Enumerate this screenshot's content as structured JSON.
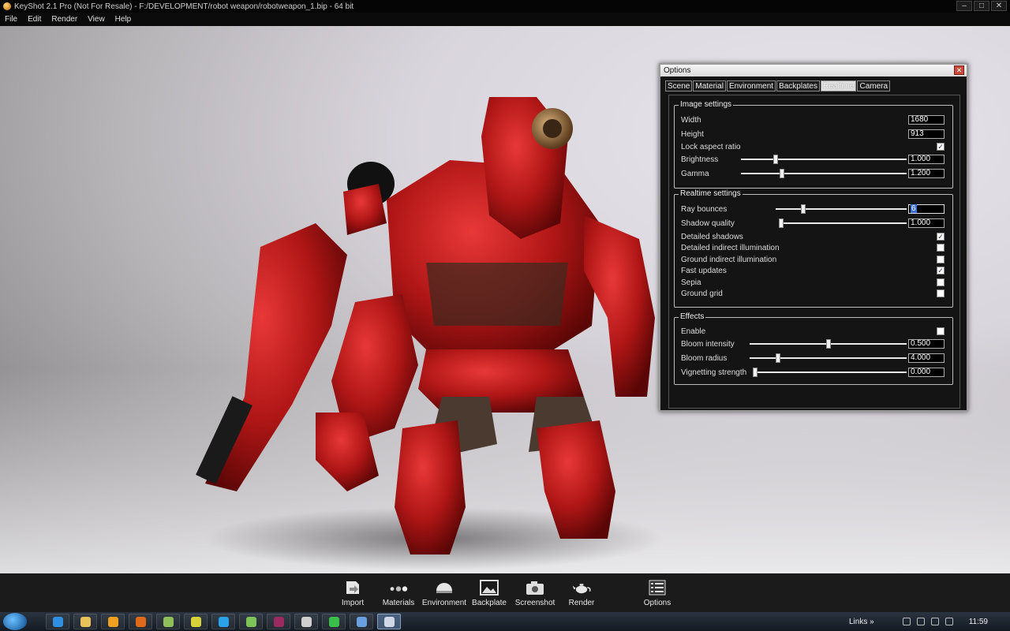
{
  "window": {
    "title": "KeyShot 2.1 Pro (Not For Resale)  -  F:/DEVELOPMENT/robot weapon/robotweapon_1.bip  - 64 bit",
    "min_glyph": "–",
    "max_glyph": "□",
    "close_glyph": "✕"
  },
  "menu": [
    "File",
    "Edit",
    "Render",
    "View",
    "Help"
  ],
  "options": {
    "title": "Options",
    "close_glyph": "✕",
    "tabs": [
      "Scene",
      "Material",
      "Environment",
      "Backplates",
      "Realtime",
      "Camera"
    ],
    "active_tab": "Realtime",
    "image_settings": {
      "legend": "Image settings",
      "width_label": "Width",
      "width_value": "1680",
      "height_label": "Height",
      "height_value": "913",
      "lock_label": "Lock aspect ratio",
      "lock_checked": true,
      "brightness_label": "Brightness",
      "brightness_value": "1.000",
      "brightness_fraction": 0.2,
      "gamma_label": "Gamma",
      "gamma_value": "1.200",
      "gamma_fraction": 0.24
    },
    "realtime_settings": {
      "legend": "Realtime settings",
      "ray_bounces_label": "Ray bounces",
      "ray_bounces_value": "6",
      "ray_bounces_fraction": 0.2,
      "shadow_quality_label": "Shadow quality",
      "shadow_quality_value": "1.000",
      "shadow_quality_fraction": 0.0,
      "checks": [
        {
          "label": "Detailed shadows",
          "checked": true
        },
        {
          "label": "Detailed indirect illumination",
          "checked": false
        },
        {
          "label": "Ground indirect illumination",
          "checked": false
        },
        {
          "label": "Fast updates",
          "checked": true
        },
        {
          "label": "Sepia",
          "checked": false
        },
        {
          "label": "Ground grid",
          "checked": false
        }
      ]
    },
    "effects": {
      "legend": "Effects",
      "enable_label": "Enable",
      "enable_checked": false,
      "bloom_intensity_label": "Bloom intensity",
      "bloom_intensity_value": "0.500",
      "bloom_intensity_fraction": 0.5,
      "bloom_radius_label": "Bloom radius",
      "bloom_radius_value": "4.000",
      "bloom_radius_fraction": 0.17,
      "vignetting_label": "Vignetting strength",
      "vignetting_value": "0.000",
      "vignetting_fraction": 0.0
    },
    "check_glyph": "✓"
  },
  "toolbar": {
    "import": "Import",
    "materials": "Materials",
    "environment": "Environment",
    "backplate": "Backplate",
    "screenshot": "Screenshot",
    "render": "Render",
    "options": "Options"
  },
  "taskbar": {
    "links": "Links",
    "links_chevron": "»",
    "clock": "11:59",
    "apps": [
      {
        "icon": "ie-icon",
        "color": "#2f8fe0"
      },
      {
        "icon": "folder-icon",
        "color": "#e8c25a"
      },
      {
        "icon": "media-player-icon",
        "color": "#f0a020"
      },
      {
        "icon": "firefox-icon",
        "color": "#e06a1a"
      },
      {
        "icon": "app-icon",
        "color": "#8fbf5a"
      },
      {
        "icon": "chrome-icon",
        "color": "#d8d23a"
      },
      {
        "icon": "skype-icon",
        "color": "#2aa3e8"
      },
      {
        "icon": "messenger-icon",
        "color": "#7ec25a"
      },
      {
        "icon": "photoshop-icon",
        "color": "#9a2a60"
      },
      {
        "icon": "user-icon",
        "color": "#cfcfcf"
      },
      {
        "icon": "whatsapp-icon",
        "color": "#3ac04a"
      },
      {
        "icon": "mail-icon",
        "color": "#6aa0e0"
      },
      {
        "icon": "keyshot-icon",
        "color": "#d0d8e8"
      }
    ]
  }
}
